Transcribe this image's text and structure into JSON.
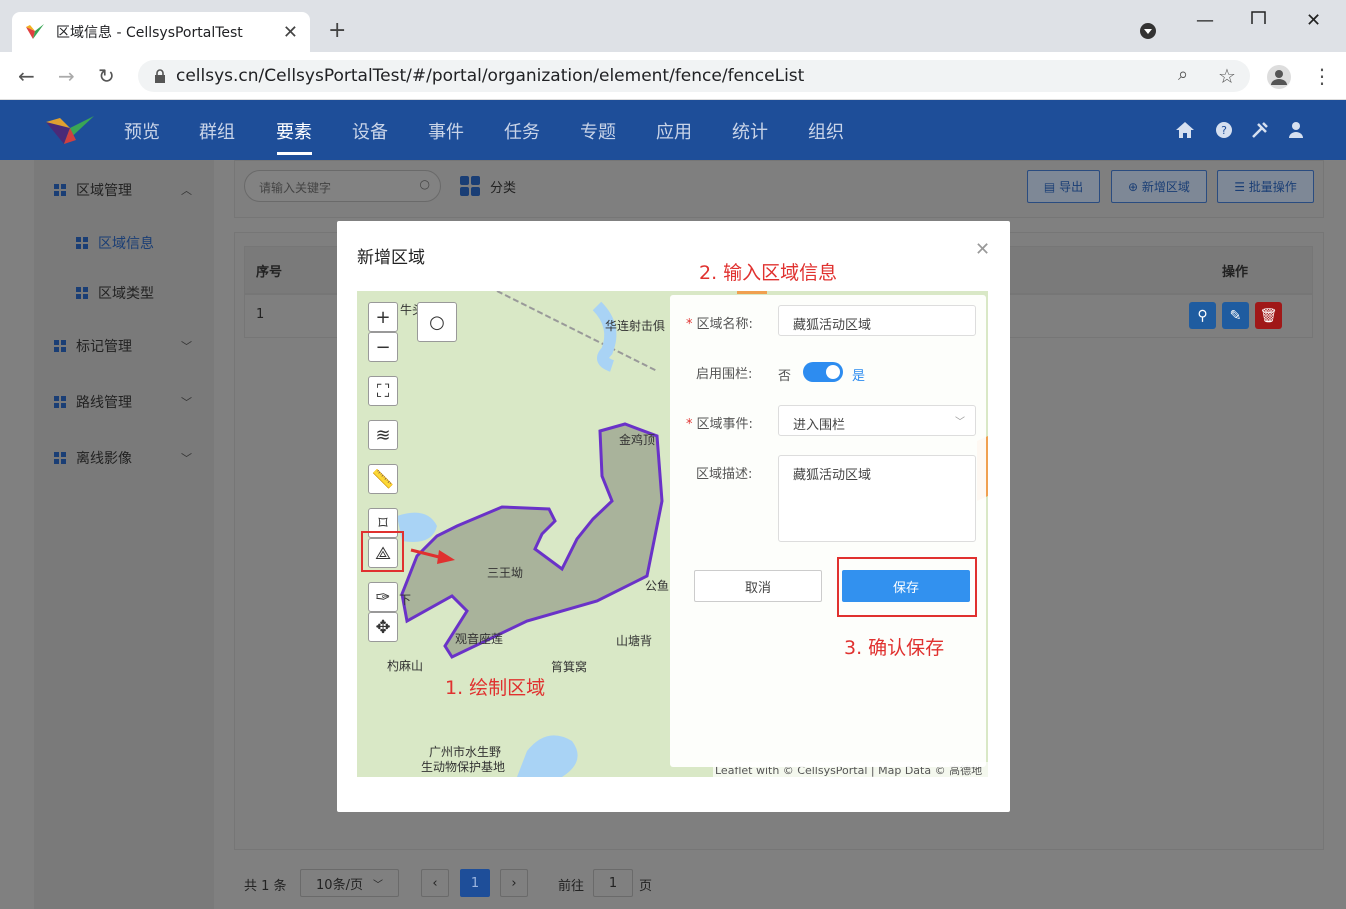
{
  "browser": {
    "tab_title": "区域信息 - CellsysPortalTest",
    "url": "cellsys.cn/CellsysPortalTest/#/portal/organization/element/fence/fenceList"
  },
  "appnav": {
    "items": [
      "预览",
      "群组",
      "要素",
      "设备",
      "事件",
      "任务",
      "专题",
      "应用",
      "统计",
      "组织"
    ],
    "active": "要素"
  },
  "sidebar": {
    "groups": [
      {
        "label": "区域管理",
        "children": [
          "区域信息",
          "区域类型"
        ]
      },
      {
        "label": "标记管理"
      },
      {
        "label": "路线管理"
      },
      {
        "label": "离线影像"
      }
    ]
  },
  "toolbar": {
    "search_placeholder": "请输入关键字",
    "category_label": "分类",
    "export_label": "导出",
    "add_label": "新增区域",
    "batch_label": "批量操作"
  },
  "table": {
    "headers": [
      "序号",
      "操作"
    ],
    "rows": [
      {
        "index": "1"
      }
    ]
  },
  "pagination": {
    "total": "共 1 条",
    "page_size": "10条/页",
    "current_page": "1",
    "goto_label": "前往",
    "goto_value": "1",
    "page_suffix": "页"
  },
  "modal": {
    "title": "新增区域",
    "annotations": {
      "step1": "1. 绘制区域",
      "step2": "2. 输入区域信息",
      "step3": "3. 确认保存"
    },
    "form": {
      "name_label": "区域名称:",
      "name_value": "藏狐活动区域",
      "fence_label": "启用围栏:",
      "fence_off": "否",
      "fence_on": "是",
      "event_label": "区域事件:",
      "event_value": "进入围栏",
      "desc_label": "区域描述:",
      "desc_value": "藏狐活动区域",
      "cancel_label": "取消",
      "save_label": "保存"
    },
    "map": {
      "pois": [
        "华连射击俱",
        "金鸡顶",
        "三王坳",
        "公鱼",
        "观音座莲",
        "山塘背",
        "筲箕窝",
        "杓麻山",
        "广州市水生野",
        "生动物保护基地",
        "牛头",
        "下"
      ],
      "attribution": "Leaflet with © CellsysPortal | Map Data © 高德地图"
    }
  }
}
